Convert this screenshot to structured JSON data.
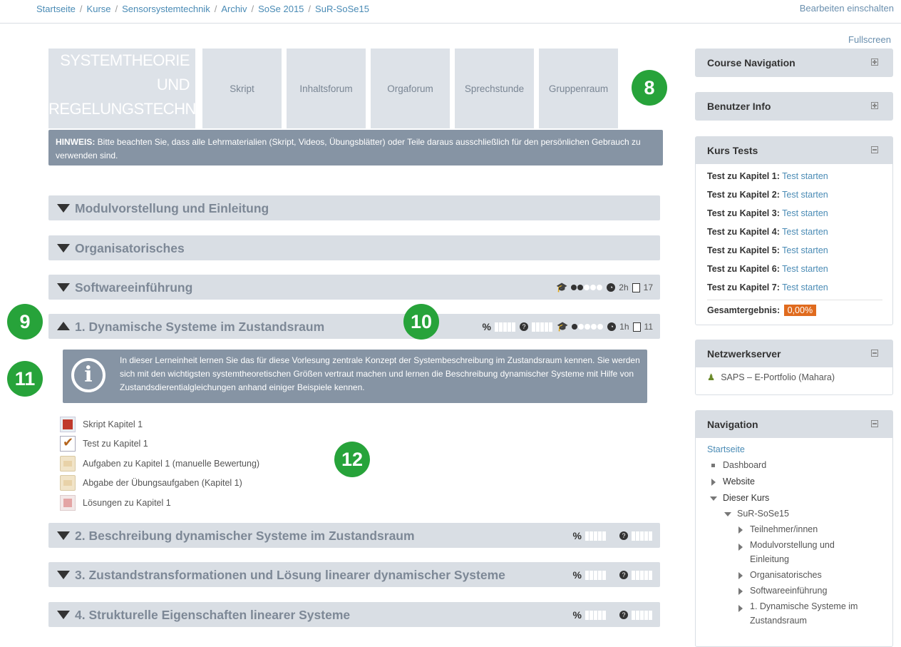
{
  "breadcrumb": [
    "Startseite",
    "Kurse",
    "Sensorsystemtechnik",
    "Archiv",
    "SoSe 2015",
    "SuR-SoSe15"
  ],
  "edit_toggle": "Bearbeiten einschalten",
  "fullscreen": "Fullscreen",
  "course_title": [
    "SYSTEMTHEORIE",
    "UND",
    "REGELUNGSTECHNIK"
  ],
  "tiles": [
    "Skript",
    "Inhaltsforum",
    "Orgaforum",
    "Sprechstunde",
    "Gruppenraum"
  ],
  "notice": {
    "label": "HINWEIS:",
    "text": " Bitte beachten Sie, dass alle Lehrmaterialien (Skript, Videos, Übungsblätter) oder Teile daraus ausschließlich für den persönlichen Gebrauch zu verwenden sind."
  },
  "sections": [
    {
      "title": "Modulvorstellung und Einleitung"
    },
    {
      "title": "Organisatorisches"
    },
    {
      "title": "Softwareeinführung",
      "level_dots": 2,
      "hours": "2h",
      "docs": "17"
    },
    {
      "title": "1. Dynamische Systeme im Zustandsraum",
      "percent_symbol": "%",
      "level_dots": 1,
      "hours": "1h",
      "docs": "11"
    },
    {
      "title": "2. Beschreibung dynamischer Systeme im Zustandsraum",
      "percent_symbol": "%"
    },
    {
      "title": "3. Zustandstransformationen und Lösung linearer dynamischer Systeme",
      "percent_symbol": "%"
    },
    {
      "title": "4. Strukturelle Eigenschaften linearer Systeme",
      "percent_symbol": "%"
    }
  ],
  "info_box": "In dieser Lerneinheit lernen Sie das für diese Vorlesung zentrale Konzept der Systembeschreibung im Zustandsraum kennen. Sie werden sich mit den wichtigsten systemtheoretischen Größen vertraut machen und lernen die Beschreibung dynamischer Systeme mit Hilfe von Zustandsdierentialgleichungen anhand einiger Beispiele kennen.",
  "activities": [
    {
      "label": "Skript Kapitel 1",
      "icon": "pdf-icon"
    },
    {
      "label": "Test zu Kapitel 1",
      "icon": "quiz-icon"
    },
    {
      "label": "Aufgaben zu Kapitel 1 (manuelle Bewertung)",
      "icon": "assignment-icon"
    },
    {
      "label": "Abgabe der Übungsaufgaben (Kapitel 1)",
      "icon": "assignment-icon"
    },
    {
      "label": "Lösungen zu Kapitel 1",
      "icon": "pdf-icon"
    }
  ],
  "badges": [
    "8",
    "9",
    "10",
    "11",
    "12"
  ],
  "sidebar": {
    "course_navigation": "Course Navigation",
    "benutzer_info": "Benutzer Info",
    "kurs_tests": {
      "title": "Kurs Tests",
      "rows": [
        {
          "label": "Test zu Kapitel 1:",
          "link": "Test starten"
        },
        {
          "label": "Test zu Kapitel 2:",
          "link": "Test starten"
        },
        {
          "label": "Test zu Kapitel 3:",
          "link": "Test starten"
        },
        {
          "label": "Test zu Kapitel 4:",
          "link": "Test starten"
        },
        {
          "label": "Test zu Kapitel 5:",
          "link": "Test starten"
        },
        {
          "label": "Test zu Kapitel 6:",
          "link": "Test starten"
        },
        {
          "label": "Test zu Kapitel 7:",
          "link": "Test starten"
        }
      ],
      "total_label": "Gesamtergebnis:",
      "total_value": "0,00%"
    },
    "netzwerkserver": {
      "title": "Netzwerkserver",
      "item": "SAPS – E-Portfolio (Mahara)"
    },
    "navigation": {
      "title": "Navigation",
      "items": [
        {
          "label": "Startseite"
        },
        {
          "label": "Dashboard"
        },
        {
          "label": "Website"
        },
        {
          "label": "Dieser Kurs"
        },
        {
          "label": "SuR-SoSe15"
        },
        {
          "label": "Teilnehmer/innen"
        },
        {
          "label": "Modulvorstellung und Einleitung"
        },
        {
          "label": "Organisatorisches"
        },
        {
          "label": "Softwareeinführung"
        },
        {
          "label": "1. Dynamische Systeme im Zustandsraum"
        }
      ]
    }
  }
}
